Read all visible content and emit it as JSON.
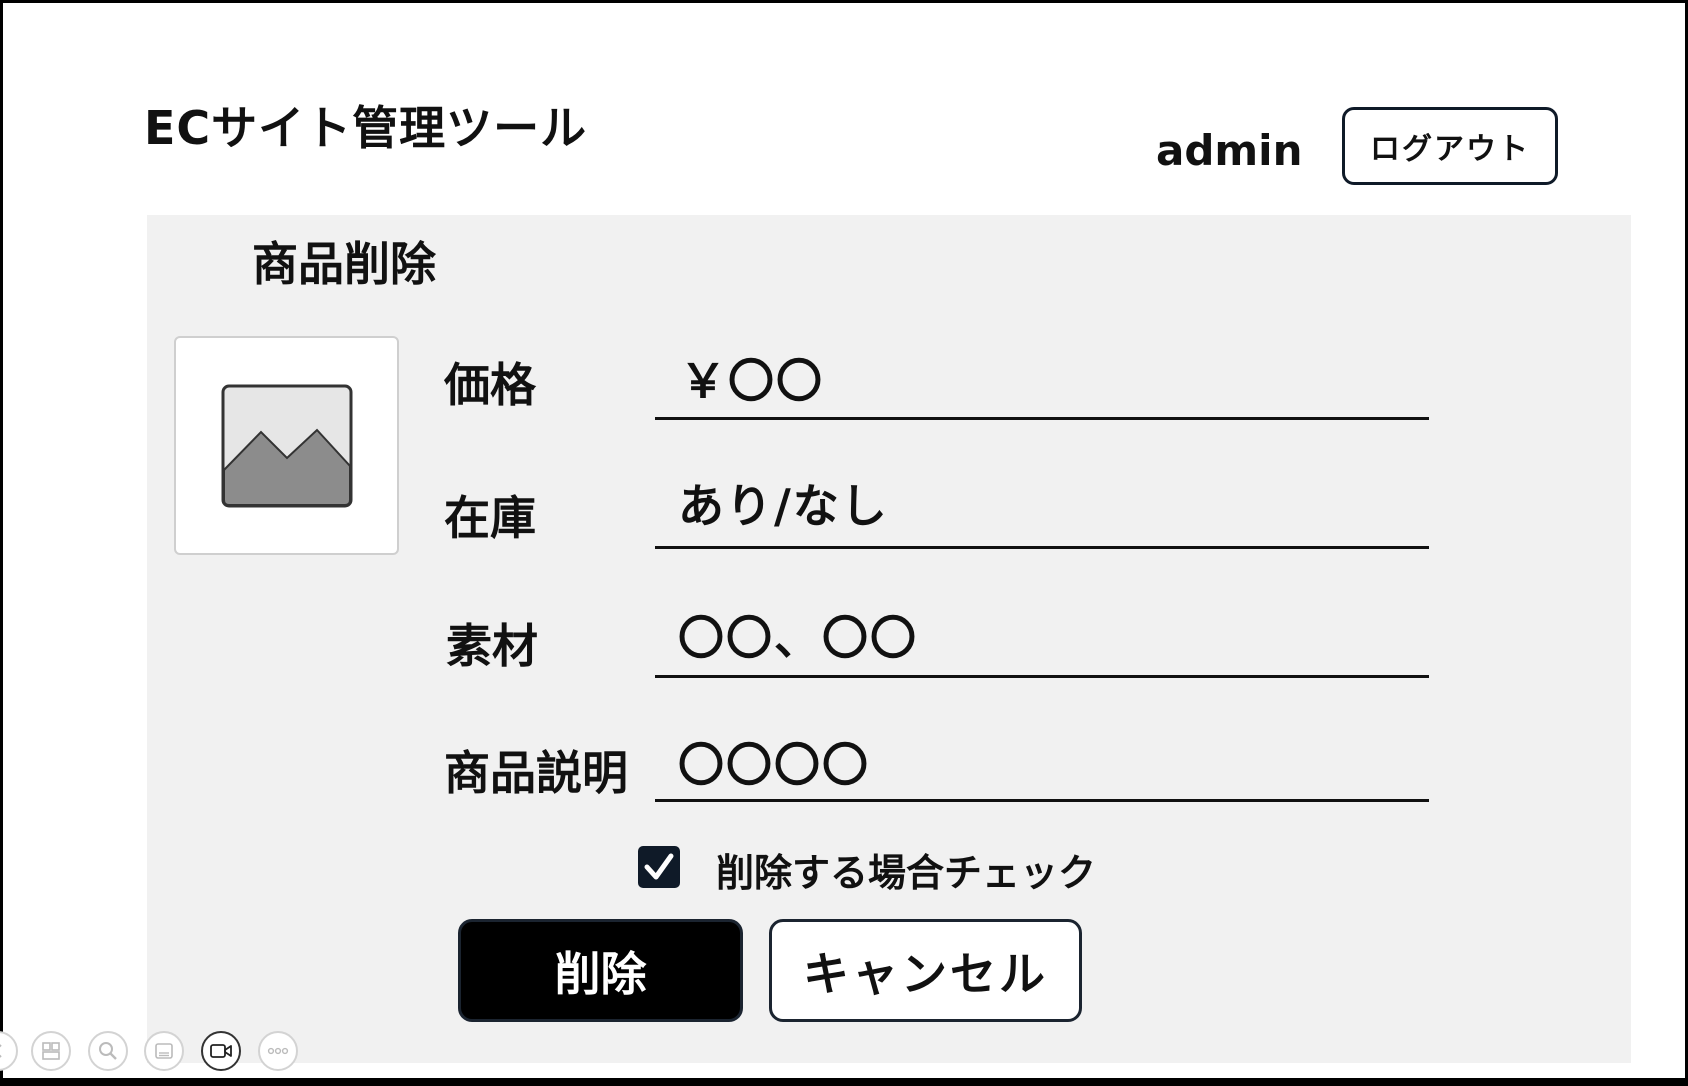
{
  "header": {
    "app_title": "ECサイト管理ツール",
    "username": "admin",
    "logout_label": "ログアウト"
  },
  "page": {
    "title": "商品削除"
  },
  "product_image": {
    "icon": "image-placeholder-icon"
  },
  "fields": [
    {
      "label": "価格",
      "value": "￥〇〇"
    },
    {
      "label": "在庫",
      "value": "あり/なし"
    },
    {
      "label": "素材",
      "value": "〇〇、〇〇"
    },
    {
      "label": "商品説明",
      "value": "〇〇〇〇"
    }
  ],
  "delete_check": {
    "label": "削除する場合チェック",
    "checked": true
  },
  "actions": {
    "delete_label": "削除",
    "cancel_label": "キャンセル"
  },
  "bottom_toolbar": {
    "icons": [
      "back-icon",
      "layout-icon",
      "zoom-icon",
      "captions-icon",
      "video-icon",
      "more-icon"
    ]
  },
  "colors": {
    "panel_bg": "#f1f1f1",
    "checkbox": "#0f1a28",
    "primary_button": "#000000"
  }
}
